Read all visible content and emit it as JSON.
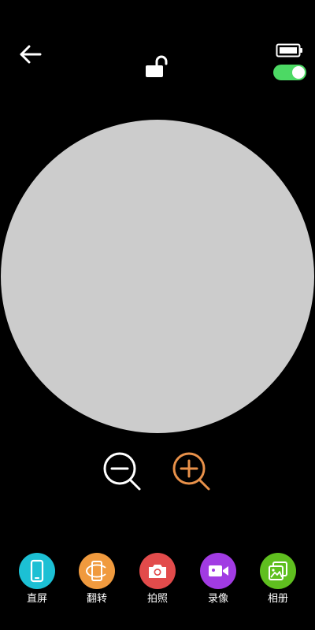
{
  "theme": {
    "background": "#000000",
    "viewport_color": "#cccccc",
    "toggle_color": "#4cd964",
    "zoom_in_color": "#e8914a",
    "zoom_out_color": "#ffffff"
  },
  "header": {
    "back_icon": "arrow-left-icon",
    "lock_icon": "unlock-icon",
    "battery_icon": "battery-icon",
    "toggle_state": "on"
  },
  "zoom": {
    "out_icon": "zoom-out-icon",
    "in_icon": "zoom-in-icon"
  },
  "actions": [
    {
      "label": "直屏",
      "icon": "phone-portrait-icon",
      "color": "#1cc0d4"
    },
    {
      "label": "翻转",
      "icon": "phone-rotate-icon",
      "color": "#f09a3e"
    },
    {
      "label": "拍照",
      "icon": "camera-icon",
      "color": "#e24b4b"
    },
    {
      "label": "录像",
      "icon": "video-camera-icon",
      "color": "#a13be3"
    },
    {
      "label": "相册",
      "icon": "gallery-icon",
      "color": "#5fbf1f"
    }
  ]
}
